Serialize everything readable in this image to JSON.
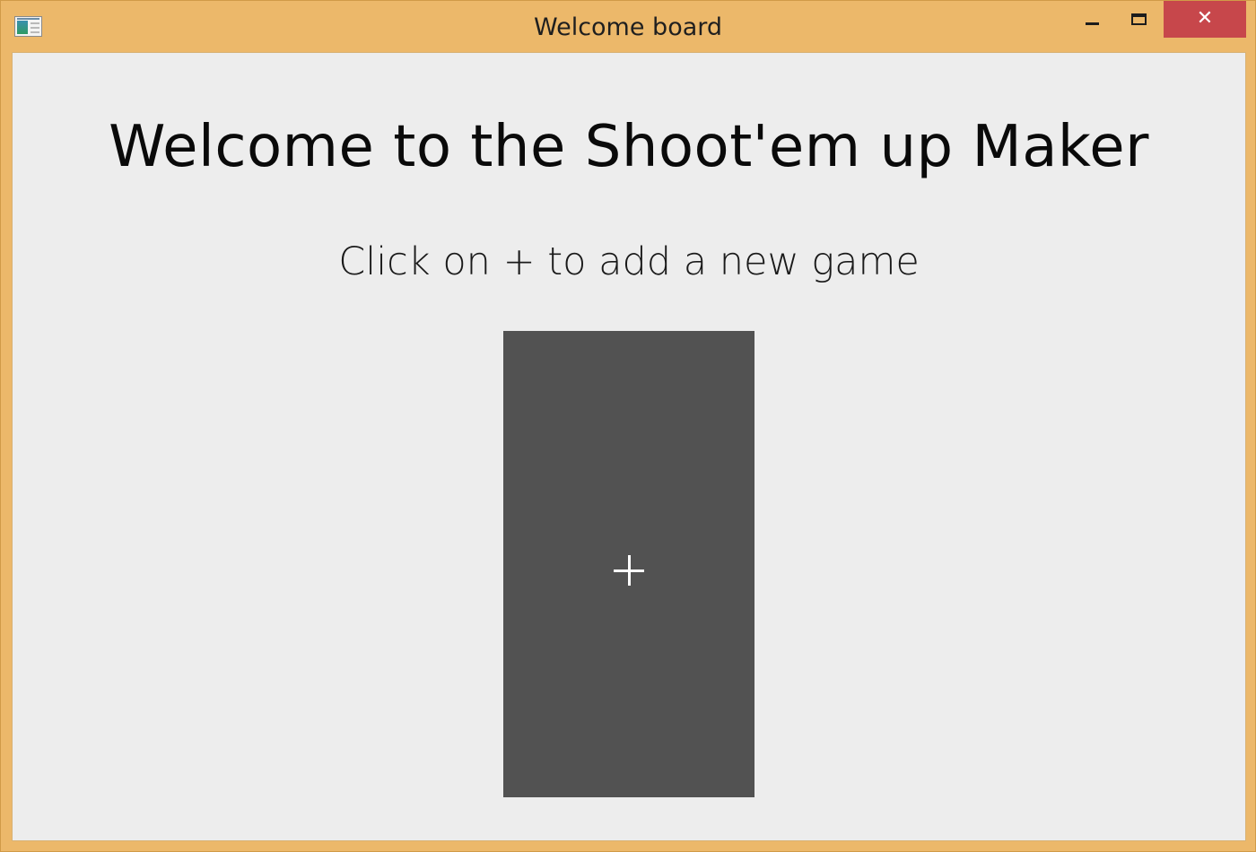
{
  "window": {
    "title": "Welcome board",
    "close_glyph": "✕",
    "frame_color": "#ecb86a",
    "close_button_color": "#c7474b"
  },
  "main": {
    "headline": "Welcome to the Shoot'em up Maker",
    "instruction": "Click on + to add a new game",
    "add_tile": {
      "icon": "plus-icon",
      "color": "#525252"
    }
  }
}
